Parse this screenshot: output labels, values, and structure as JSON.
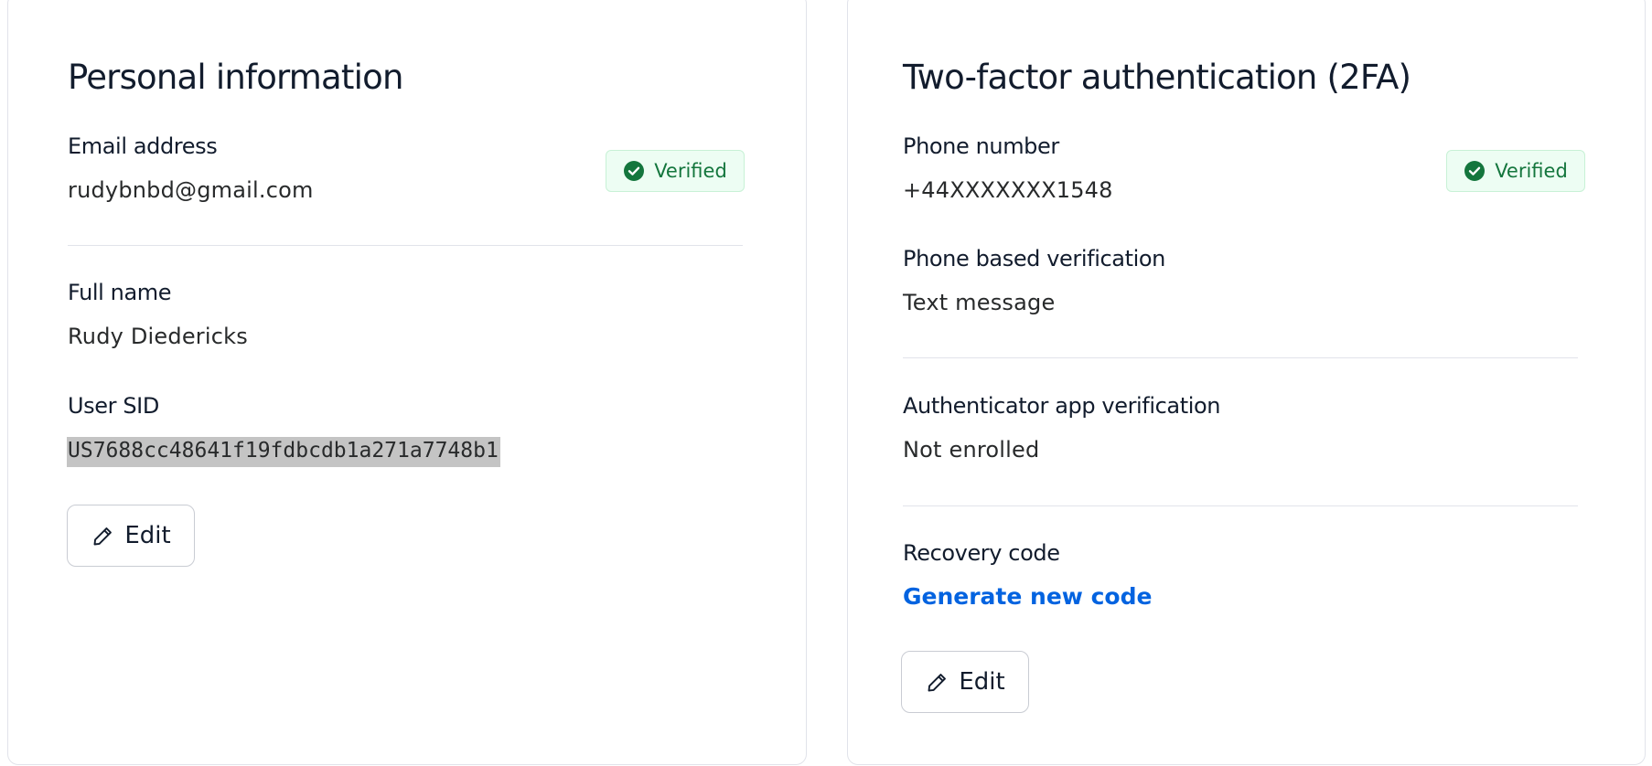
{
  "personal": {
    "title": "Personal information",
    "email": {
      "label": "Email address",
      "value": "rudybnbd@gmail.com",
      "badge": "Verified"
    },
    "full_name": {
      "label": "Full name",
      "value": "Rudy Diedericks"
    },
    "user_sid": {
      "label": "User SID",
      "value": "US7688cc48641f19fdbcdb1a271a7748b1"
    },
    "edit_label": "Edit"
  },
  "twofa": {
    "title": "Two-factor authentication (2FA)",
    "phone": {
      "label": "Phone number",
      "value": "+44XXXXXXX1548",
      "badge": "Verified"
    },
    "phone_verification": {
      "label": "Phone based verification",
      "value": "Text message"
    },
    "authenticator": {
      "label": "Authenticator app verification",
      "value": "Not enrolled"
    },
    "recovery": {
      "label": "Recovery code",
      "link": "Generate new code"
    },
    "edit_label": "Edit"
  },
  "icons": {
    "verified": "check-circle-icon",
    "edit": "pencil-icon"
  },
  "colors": {
    "verified_text": "#14763d",
    "verified_bg": "#edfdf3",
    "link": "#0263e0",
    "heading": "#121c2d"
  }
}
